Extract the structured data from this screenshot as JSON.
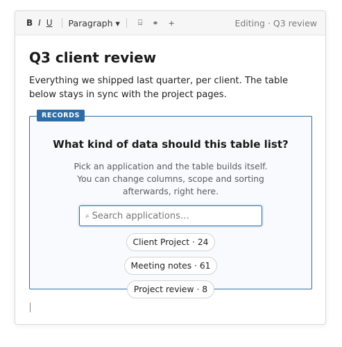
{
  "toolbar": {
    "bold_label": "B",
    "italic_label": "I",
    "underline_label": "U",
    "block_style": "Paragraph",
    "dropdown_caret": "▾",
    "icon_table": "⌸",
    "icon_link": "⚭",
    "icon_add": "+",
    "status": "Editing · Q3 review"
  },
  "document": {
    "title": "Q3 client review",
    "paragraph": "Everything we shipped last quarter, per client. The table below stays in sync with the project pages."
  },
  "records": {
    "tag": "RECORDS",
    "question": "What kind of data should this table list?",
    "help": "Pick an application and the table builds itself. You can change columns, scope and sorting afterwards, right here.",
    "search": {
      "placeholder": "Search applications…",
      "icon": "⌕"
    },
    "chips": [
      {
        "label": "Client Project · 24"
      },
      {
        "label": "Meeting notes · 61"
      },
      {
        "label": "Project review · 8"
      }
    ]
  },
  "colors": {
    "accent": "#2e6da4",
    "toolbar_bg": "#f6f6f6"
  }
}
